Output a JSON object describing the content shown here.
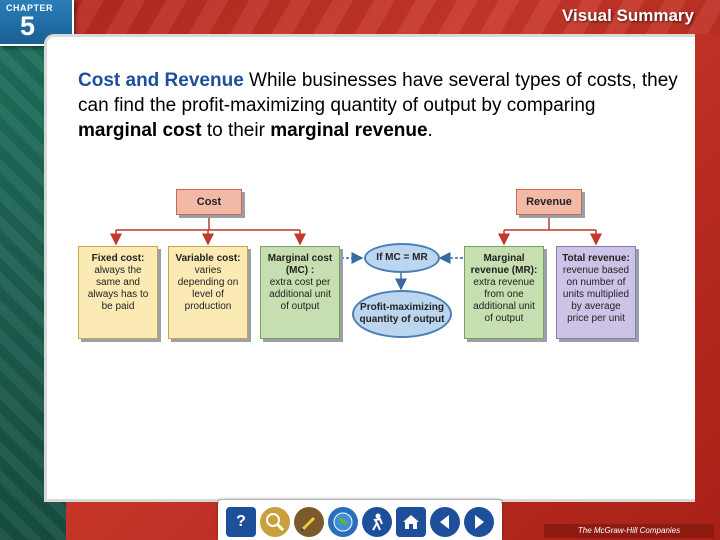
{
  "header": {
    "chapter_label": "CHAPTER",
    "chapter_number": "5",
    "section_title": "Visual Summary"
  },
  "intro": {
    "lead": "Cost and Revenue",
    "text_1": " While businesses have several types of costs, they can find the profit-maximizing quantity of output by comparing ",
    "bold_1": "marginal cost",
    "text_2": " to their ",
    "bold_2": "marginal revenue",
    "text_3": "."
  },
  "diagram": {
    "cost_header": "Cost",
    "revenue_header": "Revenue",
    "fixed_cost": {
      "title": "Fixed cost:",
      "desc": "always the same and always has to be paid"
    },
    "variable_cost": {
      "title": "Variable cost:",
      "desc": "varies depending on level of production"
    },
    "marginal_cost": {
      "title": "Marginal cost (MC) :",
      "desc": "extra cost per additional unit of output"
    },
    "condition": "If MC = MR",
    "result": "Profit-maximizing quantity of output",
    "marginal_revenue": {
      "title": "Marginal revenue (MR):",
      "desc": "extra revenue from one additional unit of output"
    },
    "total_revenue": {
      "title": "Total revenue:",
      "desc": "revenue based on number of units multiplied by average price per unit"
    }
  },
  "nav": {
    "help_icon": "question-icon",
    "publisher": "The McGraw-Hill Companies"
  },
  "colors": {
    "lead_blue": "#1d4f9a",
    "cost_header": "#f2b9a6",
    "cost_boxes": "#fbeab4",
    "marginal_boxes": "#c7dfb0",
    "total_revenue_box": "#cdc3e6",
    "ovals": "#bcd6ef"
  }
}
